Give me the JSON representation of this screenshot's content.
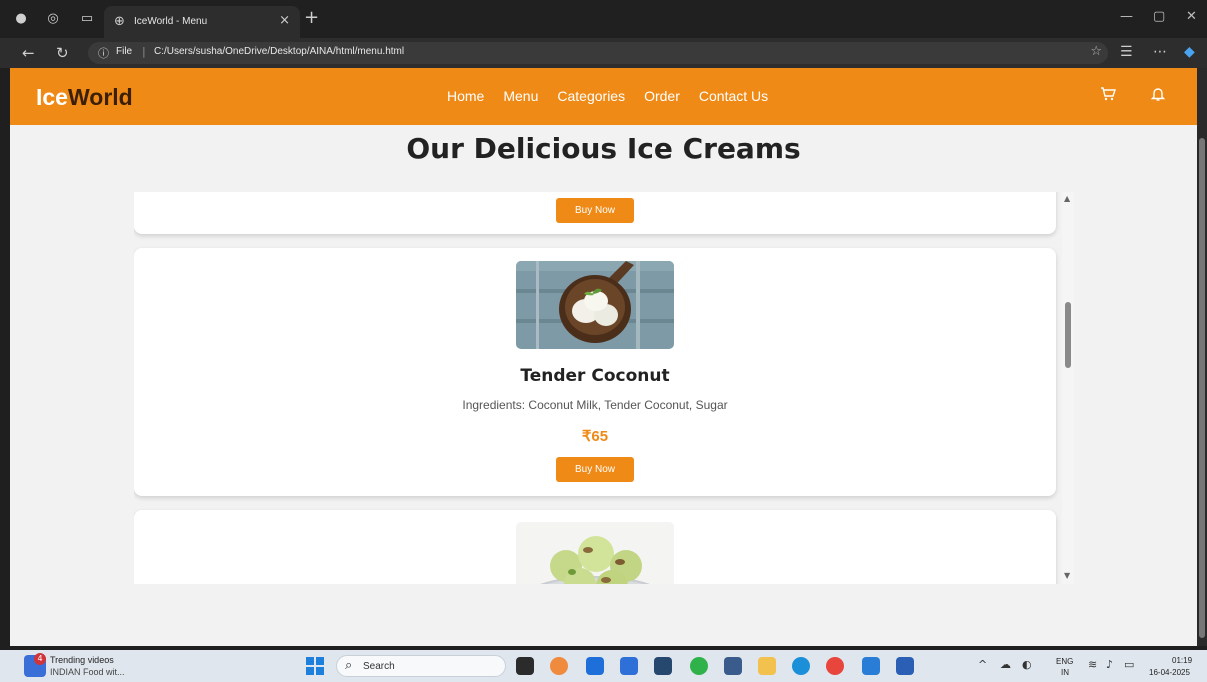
{
  "browser": {
    "tab_title": "IceWorld - Menu",
    "url_scheme_label": "File",
    "url_path": "C:/Users/susha/OneDrive/Desktop/AINA/html/menu.html"
  },
  "site": {
    "logo_accent": "Ice",
    "logo_main": "World",
    "nav": [
      "Home",
      "Menu",
      "Categories",
      "Order",
      "Contact Us"
    ],
    "page_title": "Our Delicious Ice Creams",
    "brand_color": "#ef8a17"
  },
  "cards": [
    {
      "button": "Buy Now"
    },
    {
      "name": "Tender Coconut",
      "ingredients": "Ingredients: Coconut Milk, Tender Coconut, Sugar",
      "price": "₹65",
      "button": "Buy Now",
      "image_icon": "coconut-ice-cream-image"
    },
    {
      "image_icon": "pistachio-ice-cream-image"
    }
  ],
  "taskbar": {
    "badge_count": "4",
    "news_title": "Trending videos",
    "news_subtitle": "INDIAN Food wit...",
    "search_label": "Search",
    "lang_top": "ENG",
    "lang_bottom": "IN",
    "time": "01:19",
    "date": "16-04-2025"
  }
}
